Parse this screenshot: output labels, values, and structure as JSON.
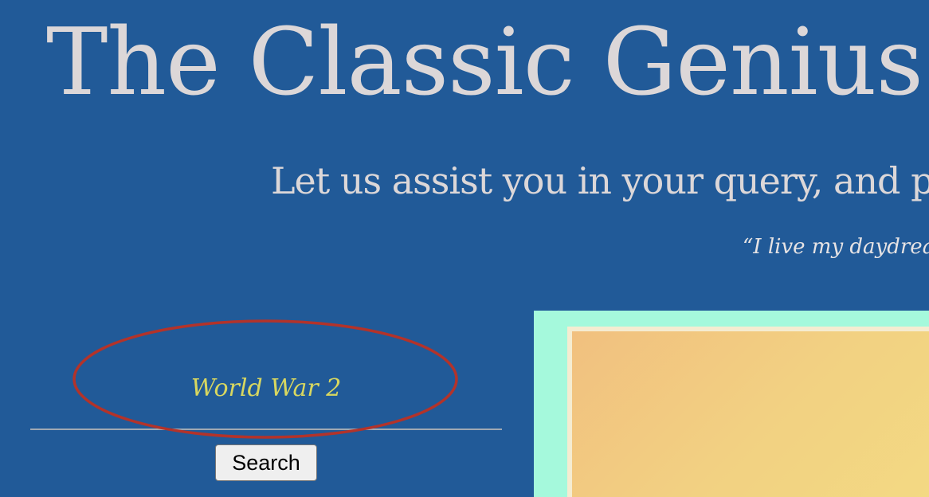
{
  "header": {
    "title": "The Classic Genius",
    "tagline": "Let us assist you in your query, and pr",
    "quote": "“I live my daydrea"
  },
  "search": {
    "value": "World War 2",
    "button_label": "Search"
  },
  "colors": {
    "background": "#215a98",
    "title_text": "#dcd7d8",
    "input_text": "#d8d760",
    "annotation": "#b3332a",
    "frame_outer": "#a5f9dc",
    "frame_inner": "#f5ecd1"
  }
}
